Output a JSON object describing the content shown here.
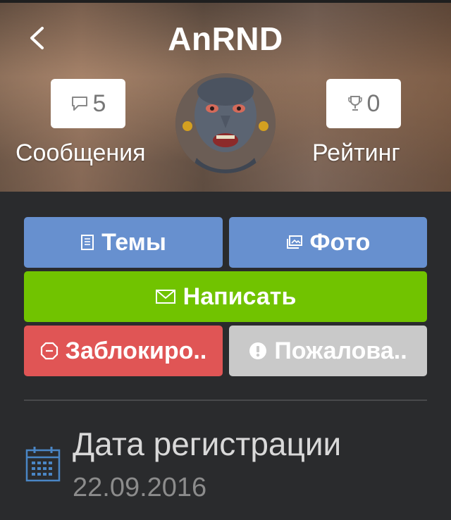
{
  "profile": {
    "username": "AnRND",
    "messages": {
      "count": "5",
      "label": "Сообщения",
      "icon": "speech-bubble-icon"
    },
    "rating": {
      "count": "0",
      "label": "Рейтинг",
      "icon": "trophy-icon"
    }
  },
  "actions": {
    "topics": {
      "label": "Темы",
      "icon": "list-icon"
    },
    "photo": {
      "label": "Фото",
      "icon": "image-icon"
    },
    "write": {
      "label": "Написать",
      "icon": "envelope-icon"
    },
    "block": {
      "label": "Заблокиро..",
      "icon": "octagon-icon"
    },
    "report": {
      "label": "Пожалова..",
      "icon": "exclamation-icon"
    }
  },
  "registration": {
    "label": "Дата регистрации",
    "value": "22.09.2016",
    "icon": "calendar-icon"
  },
  "colors": {
    "blue": "#6790cf",
    "green": "#71c300",
    "red": "#e05555",
    "grey": "#c9c9c9",
    "background": "#2a2b2d"
  }
}
